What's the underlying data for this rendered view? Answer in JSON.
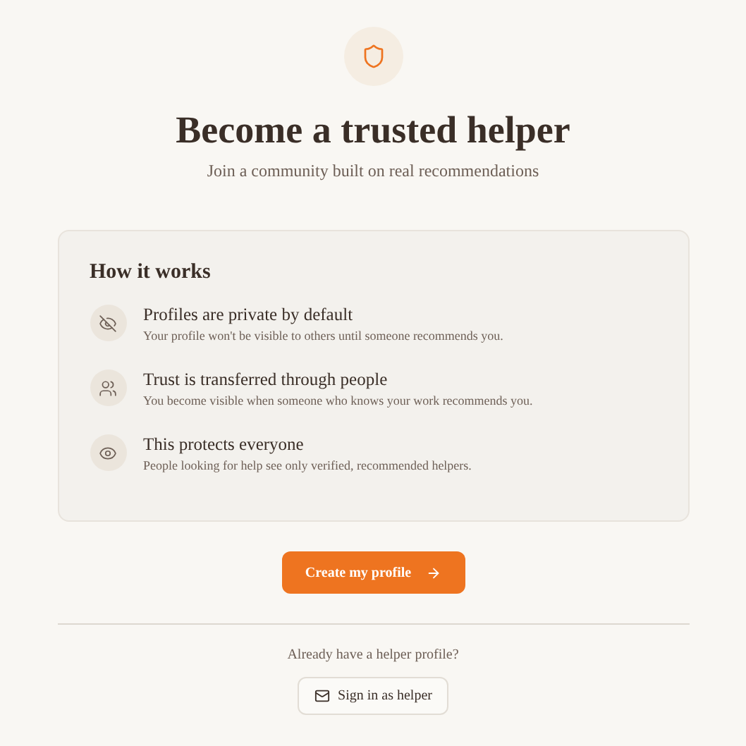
{
  "header": {
    "title": "Become a trusted helper",
    "subtitle": "Join a community built on real recommendations"
  },
  "how_it_works": {
    "title": "How it works",
    "items": [
      {
        "kind": "eye-off",
        "title": "Profiles are private by default",
        "description": "Your profile won't be visible to others until someone recommends you."
      },
      {
        "kind": "users",
        "title": "Trust is transferred through people",
        "description": "You become visible when someone who knows your work recommends you."
      },
      {
        "kind": "eye",
        "title": "This protects everyone",
        "description": "People looking for help see only verified, recommended helpers."
      }
    ]
  },
  "primary_button": {
    "label": "Create my profile"
  },
  "footer": {
    "prompt": "Already have a helper profile?",
    "button": "Sign in as helper"
  }
}
